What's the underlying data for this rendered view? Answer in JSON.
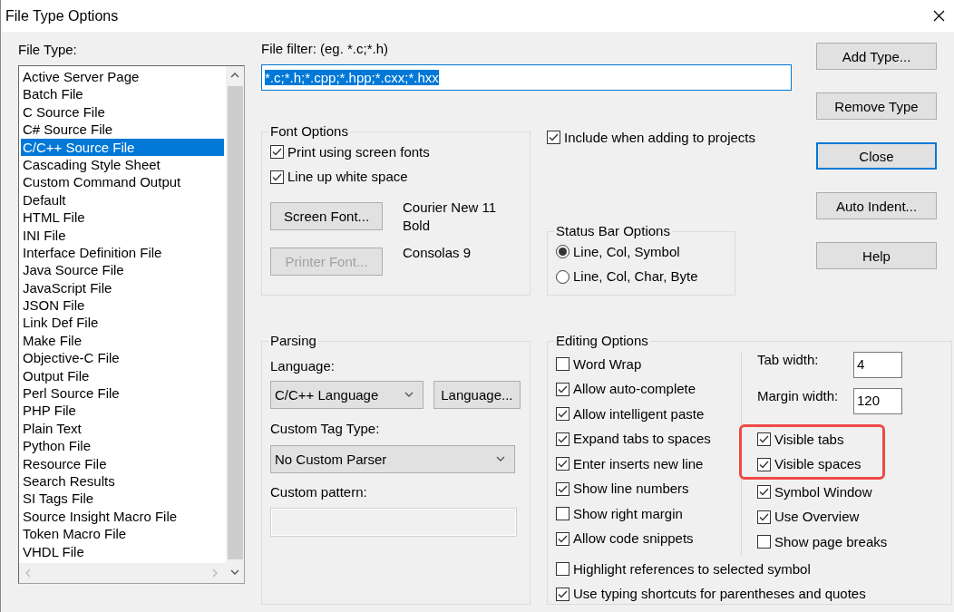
{
  "window": {
    "title": "File Type Options"
  },
  "file_type": {
    "label": "File Type:",
    "items": [
      {
        "label": "Active Server Page",
        "selected": false
      },
      {
        "label": "Batch File",
        "selected": false
      },
      {
        "label": "C Source File",
        "selected": false
      },
      {
        "label": "C# Source File",
        "selected": false
      },
      {
        "label": "C/C++ Source File",
        "selected": true
      },
      {
        "label": "Cascading Style Sheet",
        "selected": false
      },
      {
        "label": "Custom Command Output",
        "selected": false
      },
      {
        "label": "Default",
        "selected": false
      },
      {
        "label": "HTML File",
        "selected": false
      },
      {
        "label": "INI File",
        "selected": false
      },
      {
        "label": "Interface Definition File",
        "selected": false
      },
      {
        "label": "Java Source File",
        "selected": false
      },
      {
        "label": "JavaScript File",
        "selected": false
      },
      {
        "label": "JSON File",
        "selected": false
      },
      {
        "label": "Link Def File",
        "selected": false
      },
      {
        "label": "Make File",
        "selected": false
      },
      {
        "label": "Objective-C File",
        "selected": false
      },
      {
        "label": "Output File",
        "selected": false
      },
      {
        "label": "Perl Source File",
        "selected": false
      },
      {
        "label": "PHP File",
        "selected": false
      },
      {
        "label": "Plain Text",
        "selected": false
      },
      {
        "label": "Python File",
        "selected": false
      },
      {
        "label": "Resource File",
        "selected": false
      },
      {
        "label": "Search Results",
        "selected": false
      },
      {
        "label": "SI Tags File",
        "selected": false
      },
      {
        "label": "Source Insight Macro File",
        "selected": false
      },
      {
        "label": "Token Macro File",
        "selected": false
      },
      {
        "label": "VHDL File",
        "selected": false
      }
    ]
  },
  "file_filter": {
    "label": "File filter: (eg. *.c;*.h)",
    "value": "*.c;*.h;*.cpp;*.hpp;*.cxx;*.hxx"
  },
  "font_options": {
    "title": "Font Options",
    "checkboxes": [
      {
        "label": "Print using screen fonts",
        "checked": true
      },
      {
        "label": "Line up white space",
        "checked": true
      }
    ],
    "fonts": [
      {
        "button": "Screen Font...",
        "disabled": false,
        "value": "Courier New 11 Bold"
      },
      {
        "button": "Printer Font...",
        "disabled": true,
        "value": "Consolas 9"
      }
    ]
  },
  "include_option": {
    "label": "Include when adding to projects",
    "checked": true
  },
  "status_bar_options": {
    "title": "Status Bar Options",
    "options": [
      {
        "label": "Line, Col, Symbol",
        "selected": true
      },
      {
        "label": "Line, Col, Char, Byte",
        "selected": false
      }
    ]
  },
  "buttons": [
    {
      "label": "Add Type...",
      "default": false
    },
    {
      "label": "Remove Type",
      "default": false
    },
    {
      "label": "Close",
      "default": true
    },
    {
      "label": "Auto Indent...",
      "default": false
    },
    {
      "label": "Help",
      "default": false
    }
  ],
  "parsing": {
    "title": "Parsing",
    "language_label": "Language:",
    "language_value": "C/C++ Language",
    "language_button": "Language...",
    "tag_label": "Custom Tag Type:",
    "tag_value": "No Custom Parser",
    "pattern_label": "Custom pattern:"
  },
  "editing_options": {
    "title": "Editing Options",
    "left": [
      {
        "label": "Word Wrap",
        "checked": false
      },
      {
        "label": "Allow auto-complete",
        "checked": true
      },
      {
        "label": "Allow intelligent paste",
        "checked": true
      },
      {
        "label": "Expand tabs to spaces",
        "checked": true
      },
      {
        "label": "Enter inserts new line",
        "checked": true
      },
      {
        "label": "Show line numbers",
        "checked": true
      },
      {
        "label": "Show right margin",
        "checked": false
      },
      {
        "label": "Allow code snippets",
        "checked": true
      }
    ],
    "fields": [
      {
        "label": "Tab width:",
        "value": "4"
      },
      {
        "label": "Margin width:",
        "value": "120"
      }
    ],
    "right": [
      {
        "label": "Visible tabs",
        "checked": true,
        "highlighted": true
      },
      {
        "label": "Visible spaces",
        "checked": true,
        "highlighted": true
      },
      {
        "label": "Symbol Window",
        "checked": true,
        "highlighted": false
      },
      {
        "label": "Use Overview",
        "checked": true,
        "highlighted": false
      },
      {
        "label": "Show page breaks",
        "checked": false,
        "highlighted": false
      }
    ],
    "bottom": [
      {
        "label": "Highlight references to selected symbol",
        "checked": false
      },
      {
        "label": "Use typing shortcuts for parentheses and quotes",
        "checked": true
      }
    ]
  }
}
